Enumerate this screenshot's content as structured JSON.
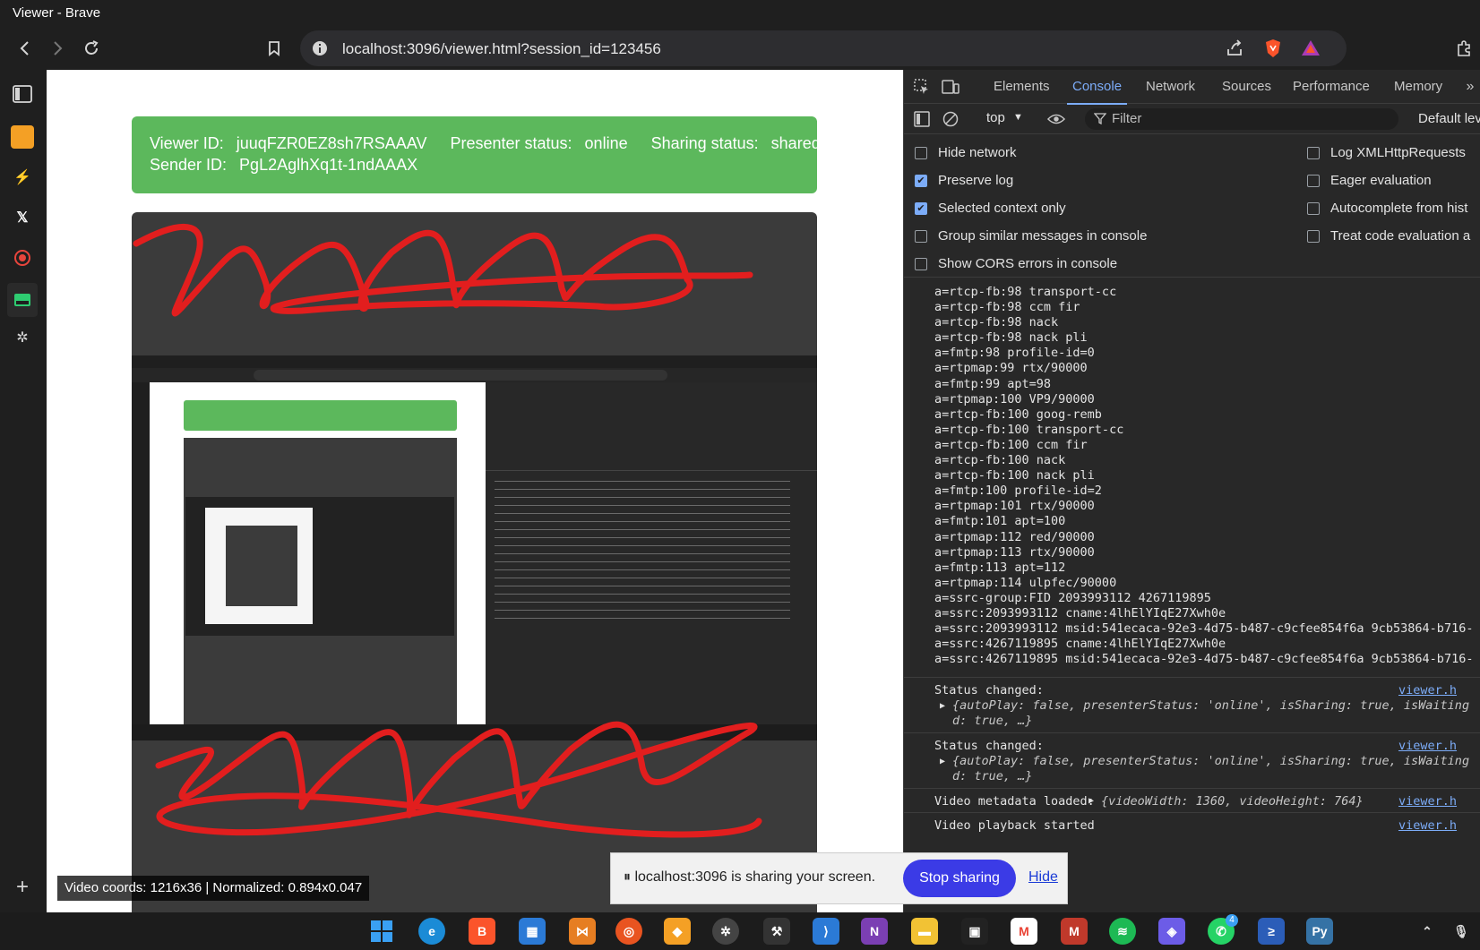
{
  "window": {
    "title": "Viewer - Brave"
  },
  "toolbar": {
    "url": "localhost:3096/viewer.html?session_id=123456"
  },
  "status_panel": {
    "viewer_id_label": "Viewer ID:",
    "viewer_id": "juuqFZR0EZ8sh7RSAAAV",
    "presenter_status_label": "Presenter status:",
    "presenter_status": "online",
    "sharing_status_label": "Sharing status:",
    "sharing_status": "shared",
    "sender_id_label": "Sender ID:",
    "sender_id": "PgL2AglhXq1t-1ndAAAX"
  },
  "video": {
    "coords_readout": "Video coords: 1216x36 | Normalized: 0.894x0.047"
  },
  "devtools": {
    "tabs": [
      "Elements",
      "Console",
      "Network",
      "Sources",
      "Performance",
      "Memory"
    ],
    "active_tab": "Console",
    "context": "top",
    "filter_placeholder": "Filter",
    "default_levels": "Default lev",
    "settings_left": [
      {
        "label": "Hide network",
        "checked": false
      },
      {
        "label": "Preserve log",
        "checked": true
      },
      {
        "label": "Selected context only",
        "checked": true
      },
      {
        "label": "Group similar messages in console",
        "checked": false
      },
      {
        "label": "Show CORS errors in console",
        "checked": false
      }
    ],
    "settings_right": [
      {
        "label": "Log XMLHttpRequests",
        "checked": false
      },
      {
        "label": "Eager evaluation",
        "checked": false
      },
      {
        "label": "Autocomplete from hist",
        "checked": false
      },
      {
        "label": "Treat code evaluation a",
        "checked": false
      }
    ],
    "sdp_lines": [
      "a=rtcp-fb:98 transport-cc",
      "a=rtcp-fb:98 ccm fir",
      "a=rtcp-fb:98 nack",
      "a=rtcp-fb:98 nack pli",
      "a=fmtp:98 profile-id=0",
      "a=rtpmap:99 rtx/90000",
      "a=fmtp:99 apt=98",
      "a=rtpmap:100 VP9/90000",
      "a=rtcp-fb:100 goog-remb",
      "a=rtcp-fb:100 transport-cc",
      "a=rtcp-fb:100 ccm fir",
      "a=rtcp-fb:100 nack",
      "a=rtcp-fb:100 nack pli",
      "a=fmtp:100 profile-id=2",
      "a=rtpmap:101 rtx/90000",
      "a=fmtp:101 apt=100",
      "a=rtpmap:112 red/90000",
      "a=rtpmap:113 rtx/90000",
      "a=fmtp:113 apt=112",
      "a=rtpmap:114 ulpfec/90000",
      "a=ssrc-group:FID 2093993112 4267119895",
      "a=ssrc:2093993112 cname:4lhElYIqE27Xwh0e",
      "a=ssrc:2093993112 msid:541ecaca-92e3-4d75-b487-c9cfee854f6a 9cb53864-b716-",
      "a=ssrc:4267119895 cname:4lhElYIqE27Xwh0e",
      "a=ssrc:4267119895 msid:541ecaca-92e3-4d75-b487-c9cfee854f6a 9cb53864-b716-"
    ],
    "messages": {
      "status1_title": "Status changed:",
      "status2_title": "Status changed:",
      "status_obj_a": "{autoPlay: false, presenterStatus: 'online', isSharing: true, isWaiting",
      "status_obj_b": "d: true, …}",
      "meta_title": "Video metadata loaded:",
      "meta_obj": "{videoWidth: 1360, videoHeight: 764}",
      "playback": "Video playback started",
      "source": "viewer.h"
    }
  },
  "share_notification": {
    "message": "localhost:3096 is sharing your screen.",
    "stop_label": "Stop sharing",
    "hide_label": "Hide"
  },
  "taskbar": {
    "whatsapp_badge": "4"
  }
}
